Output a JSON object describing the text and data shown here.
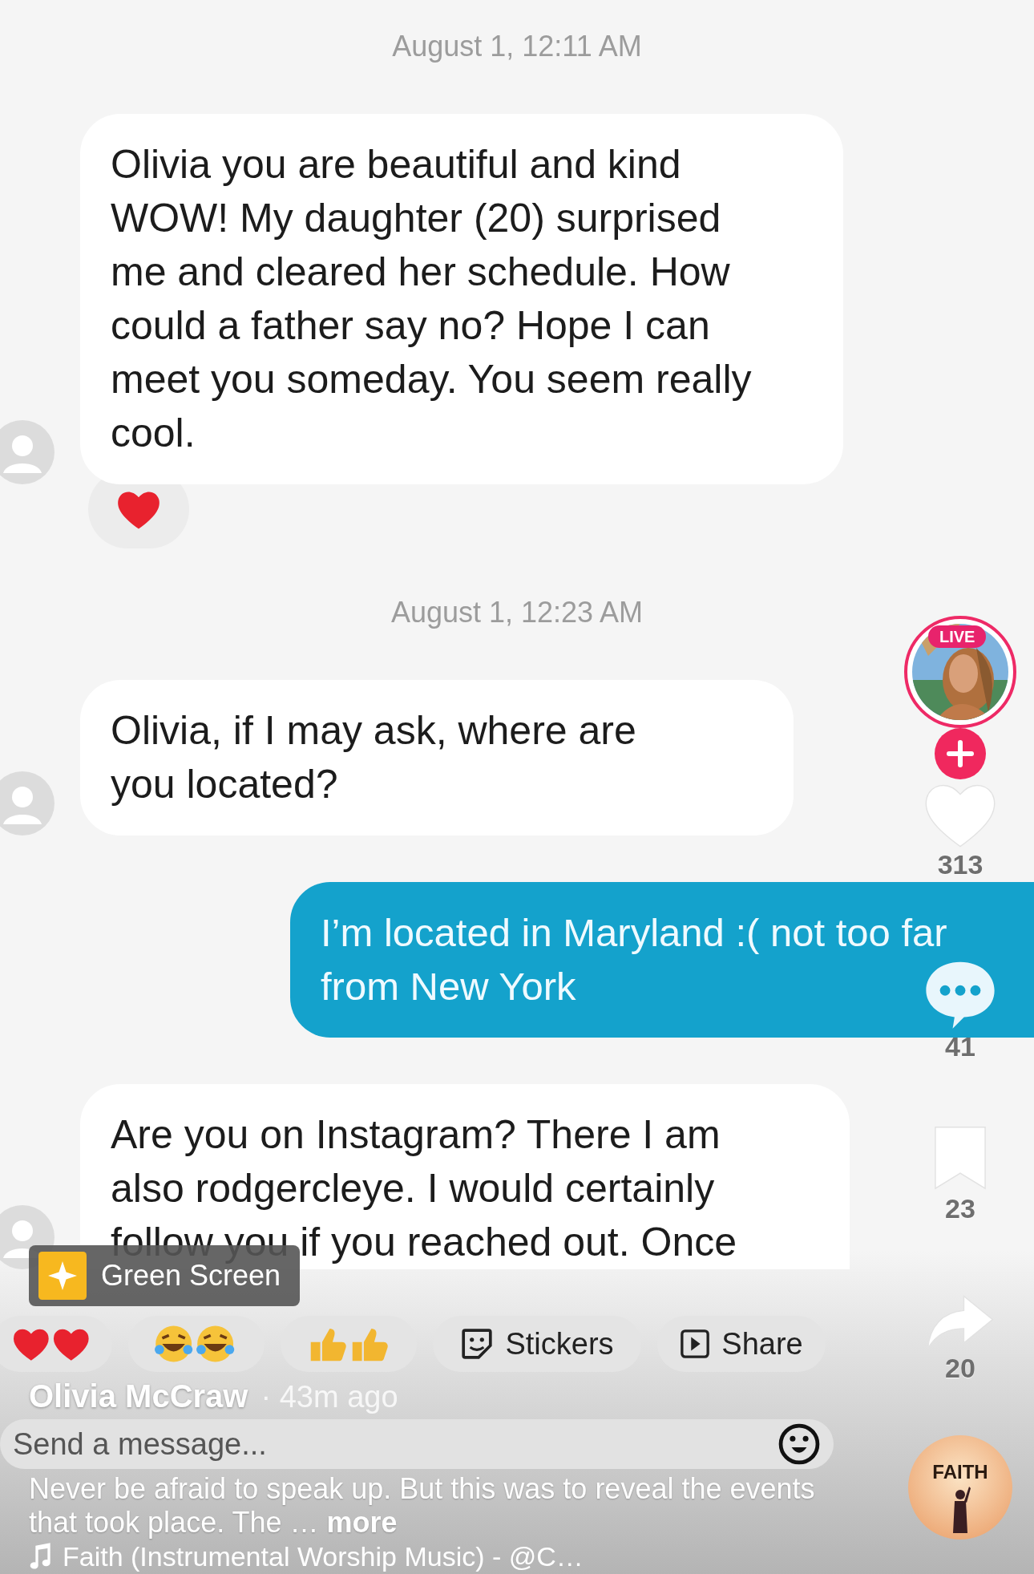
{
  "chat": {
    "items": [
      {
        "kind": "timestamp",
        "text": "August 1, 12:11 AM"
      },
      {
        "kind": "incoming",
        "text": "Olivia you are beautiful and kind WOW! My daughter (20) surprised me and cleared her schedule. How could a father say no? Hope I can meet you someday. You seem really cool.",
        "hearted": true
      },
      {
        "kind": "timestamp",
        "text": "August 1, 12:23 AM"
      },
      {
        "kind": "incoming",
        "text": "Olivia, if I may ask, where are you located?",
        "hearted": false
      },
      {
        "kind": "outgoing",
        "text": "I’m located in Maryland :( not too far from New York"
      },
      {
        "kind": "incoming_cut",
        "text": "Are you on Instagram? There I am also rodgercleye. I would certainly follow you if you reached out. Once",
        "hearted": false
      }
    ]
  },
  "quick_replies": [
    {
      "kind": "hearts"
    },
    {
      "kind": "laughs"
    },
    {
      "kind": "thumbs"
    },
    {
      "kind": "stickers",
      "label": "Stickers"
    },
    {
      "kind": "share",
      "label": "Share"
    }
  ],
  "message_input": {
    "placeholder": "Send a message..."
  },
  "effect_chip": {
    "label": "Green Screen"
  },
  "creator": {
    "name": "Olivia McCraw",
    "time": "· 43m ago",
    "live_badge": "LIVE"
  },
  "caption": {
    "text": "Never be afraid to speak up. But this was to reveal the events that took place. The …",
    "more": "more"
  },
  "sound": {
    "text": "Faith (Instrumental Worship Music) - @C…",
    "disc_label": "FAITH"
  },
  "actions": [
    {
      "kind": "like",
      "count": "313"
    },
    {
      "kind": "comment",
      "count": "41"
    },
    {
      "kind": "save",
      "count": "23"
    },
    {
      "kind": "share",
      "count": "20"
    }
  ]
}
